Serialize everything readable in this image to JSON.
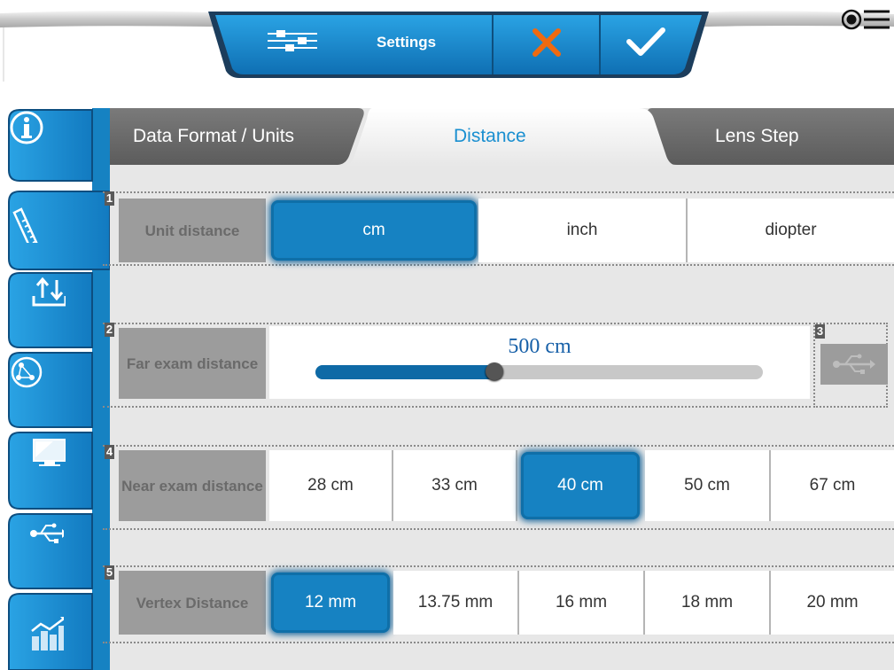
{
  "toolbar": {
    "settings_label": "Settings",
    "icons": [
      "sliders-icon",
      "close-icon",
      "check-icon",
      "menu-icon"
    ],
    "colors": {
      "blue": "#1682c2",
      "cancel": "#f06a10"
    }
  },
  "sidenav": {
    "items": [
      {
        "icon": "info-icon"
      },
      {
        "icon": "ruler-icon"
      },
      {
        "icon": "import-export-icon"
      },
      {
        "icon": "network-icon"
      },
      {
        "icon": "monitor-icon"
      },
      {
        "icon": "usb-icon"
      },
      {
        "icon": "statistics-icon"
      }
    ],
    "active_index": 1
  },
  "tabs": [
    {
      "label": "Data Format / Units"
    },
    {
      "label": "Distance"
    },
    {
      "label": "Lens Step"
    }
  ],
  "active_tab": 1,
  "rows": {
    "unit_distance": {
      "num": "1",
      "label": "Unit distance",
      "options": [
        "cm",
        "inch",
        "diopter"
      ],
      "selected": "cm"
    },
    "far_exam": {
      "num": "2",
      "label": "Far exam distance",
      "value": "500 cm",
      "slider_fraction": 0.4
    },
    "usb_button": {
      "num": "3",
      "icon": "usb-icon"
    },
    "near_exam": {
      "num": "4",
      "label": "Near exam distance",
      "options": [
        "28 cm",
        "33 cm",
        "40 cm",
        "50 cm",
        "67 cm"
      ],
      "selected": "40 cm"
    },
    "vertex": {
      "num": "5",
      "label": "Vertex Distance",
      "options": [
        "12 mm",
        "13.75 mm",
        "16 mm",
        "18 mm",
        "20 mm"
      ],
      "selected": "12 mm"
    }
  }
}
